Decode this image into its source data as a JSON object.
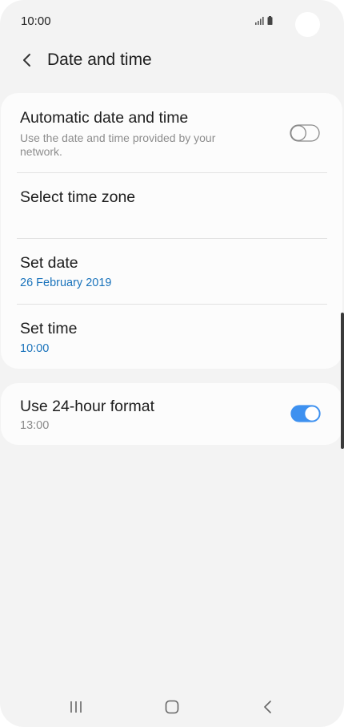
{
  "status_bar": {
    "time": "10:00",
    "icons": [
      "signal-icon",
      "battery-icon"
    ]
  },
  "header": {
    "title": "Date and time",
    "back_icon": "chevron-left-icon"
  },
  "settings": {
    "automatic": {
      "title": "Automatic date and time",
      "subtitle": "Use the date and time provided by your network.",
      "toggle_on": false
    },
    "time_zone": {
      "title": "Select time zone"
    },
    "set_date": {
      "title": "Set date",
      "value": "26 February 2019"
    },
    "set_time": {
      "title": "Set time",
      "value": "10:00"
    },
    "format_24h": {
      "title": "Use 24-hour format",
      "value": "13:00",
      "toggle_on": true
    }
  },
  "colors": {
    "accent": "#3e91f0",
    "value_blue": "#1a73bb",
    "background": "#f3f3f3",
    "card": "#fcfcfc"
  },
  "nav_bar": {
    "icons": [
      "recent-apps-icon",
      "home-icon",
      "back-icon"
    ]
  }
}
